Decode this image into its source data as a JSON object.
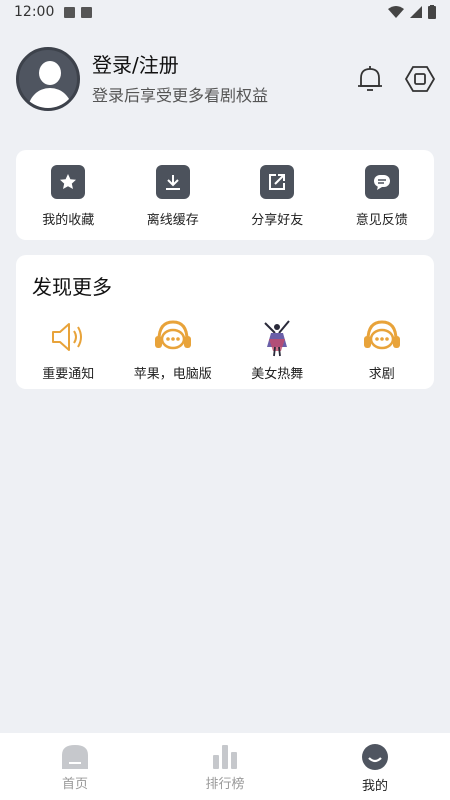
{
  "status_bar": {
    "time": "12:00"
  },
  "profile": {
    "title": "登录/注册",
    "subtitle": "登录后享受更多看剧权益"
  },
  "quick_actions": [
    {
      "label": "我的收藏",
      "icon": "star-icon"
    },
    {
      "label": "离线缓存",
      "icon": "download-icon"
    },
    {
      "label": "分享好友",
      "icon": "share-icon"
    },
    {
      "label": "意见反馈",
      "icon": "feedback-icon"
    }
  ],
  "discover": {
    "title": "发现更多",
    "items": [
      {
        "label": "重要通知",
        "icon": "speaker-icon"
      },
      {
        "label": "苹果，电脑版",
        "icon": "headset-chat-icon"
      },
      {
        "label": "美女热舞",
        "icon": "dancer-icon"
      },
      {
        "label": "求剧",
        "icon": "headset-chat-icon"
      }
    ]
  },
  "bottom_nav": [
    {
      "label": "首页",
      "icon": "home-icon"
    },
    {
      "label": "排行榜",
      "icon": "ranking-icon"
    },
    {
      "label": "我的",
      "icon": "profile-icon",
      "active": true
    }
  ],
  "colors": {
    "accent_orange": "#e8a33a",
    "icon_dark": "#4c525c",
    "background": "#eef0f4"
  }
}
